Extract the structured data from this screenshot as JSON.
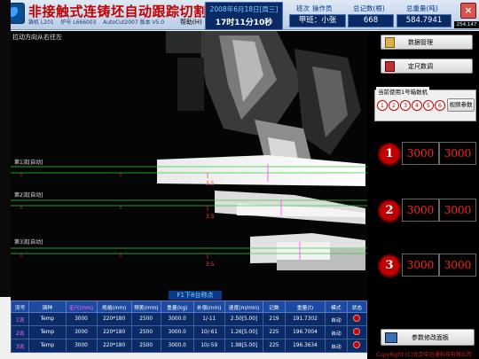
{
  "header": {
    "title": "非接触式连铸坯自动跟踪切割系统",
    "station": "铸机 L201",
    "furnace_label": "炉号 L666003",
    "version": "AutoCut2007 版本 V5.0",
    "help_label": "帮助(H)",
    "date": "2008年6月18日[周三]",
    "time": "17时11分10秒",
    "shift_label": "班次",
    "operator_label": "操作员",
    "shift_value": "甲班：小张",
    "total_count_label": "总记数(根)",
    "total_count_value": "668",
    "total_weight_label": "总重量(吨)",
    "total_weight_value": "584.7941",
    "close_label": "×",
    "corner_id": "254.147"
  },
  "camera": {
    "direction_text": "拉动方向从右往左",
    "bottom_caption": "F1下8台称点",
    "strands": [
      {
        "label": "第1流[自动]",
        "mark": "3.5"
      },
      {
        "label": "第2流[自动]",
        "mark": "3.5"
      },
      {
        "label": "第3流[自动]",
        "mark": "3.5"
      }
    ]
  },
  "right_panel": {
    "data_manage_label": "数据管理",
    "fixed_length_label": "定尺数调",
    "current_group_label": "当前使用1号箱数机",
    "group_buttons": [
      "1",
      "2",
      "3",
      "4",
      "5",
      "6"
    ],
    "video_params_label": "视频参数",
    "strand_rows": [
      {
        "num": "1",
        "set": "3000",
        "actual": "3000"
      },
      {
        "num": "2",
        "set": "3000",
        "actual": "3000"
      },
      {
        "num": "3",
        "set": "3000",
        "actual": "3000"
      }
    ],
    "params_panel_label": "参数修改面板",
    "copyright": "CopyRight (C)北京中迅通科技有限公司"
  },
  "table": {
    "headers": [
      "流号",
      "钢种",
      "定尺(mm)",
      "规格(mm)",
      "预美(mm)",
      "重量(kg)",
      "补偿(mm)",
      "速度(m/min)",
      "记数",
      "重量(t)",
      "模式",
      "状态"
    ],
    "rows": [
      [
        "1流",
        "Temp",
        "3000",
        "220*180",
        "2500",
        "3000.0",
        "1/-11",
        "2.50[5.00]",
        "219",
        "191.7302",
        "自动",
        ""
      ],
      [
        "2流",
        "Temp",
        "3000",
        "220*180",
        "2500",
        "3000.0",
        "10/-61",
        "1.26[5.00]",
        "225",
        "196.7004",
        "自动",
        ""
      ],
      [
        "3流",
        "Temp",
        "3000",
        "220*180",
        "2500",
        "3000.0",
        "10/-59",
        "1.98[5.00]",
        "225",
        "196.3634",
        "自动",
        ""
      ]
    ]
  }
}
